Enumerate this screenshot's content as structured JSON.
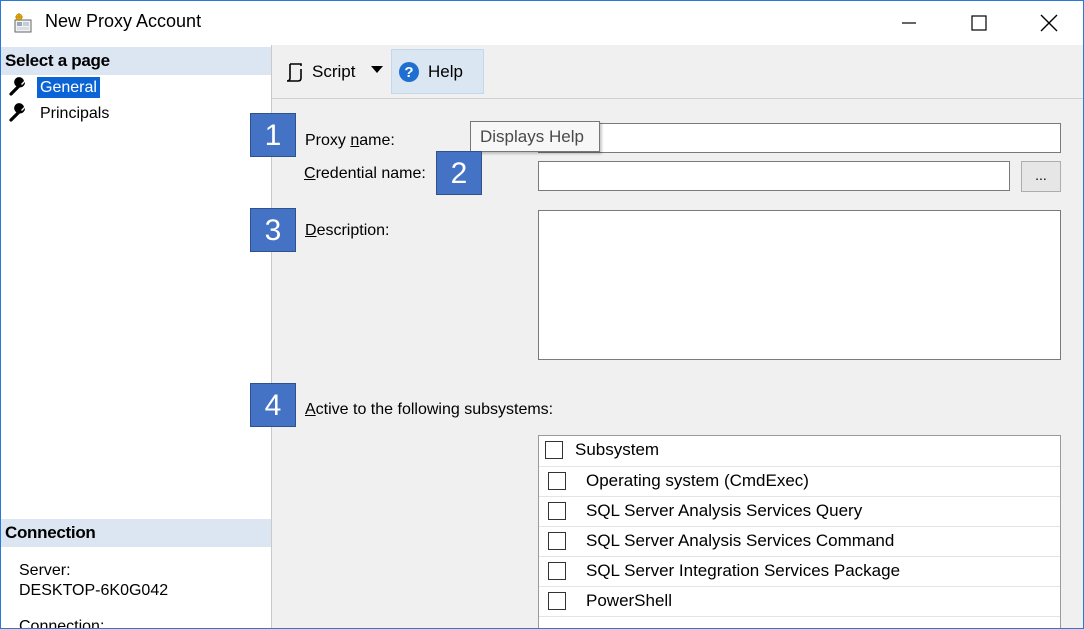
{
  "window": {
    "title": "New Proxy Account"
  },
  "left_pane": {
    "select_page_header": "Select a page",
    "pages": [
      {
        "label": "General",
        "selected": true,
        "icon": "wrench-icon"
      },
      {
        "label": "Principals",
        "selected": false,
        "icon": "wrench-icon"
      }
    ],
    "connection_header": "Connection",
    "server_label": "Server:",
    "server_value": "DESKTOP-6K0G042",
    "connection_label": "Connection:"
  },
  "toolbar": {
    "script_label": "Script",
    "help_label": "Help",
    "help_tooltip": "Displays Help"
  },
  "form": {
    "proxy_name_label_pre": "Proxy ",
    "proxy_name_label_u": "n",
    "proxy_name_label_post": "ame:",
    "proxy_name_value": "",
    "credential_label_u": "C",
    "credential_label_post": "redential name:",
    "credential_value": "",
    "browse_label": "...",
    "description_label_u": "D",
    "description_label_post": "escription:",
    "description_value": "",
    "subsystems_label_u": "A",
    "subsystems_label_post": "ctive to the following subsystems:"
  },
  "badges": [
    "1",
    "2",
    "3",
    "4"
  ],
  "subsystems": {
    "header": "Subsystem",
    "items": [
      {
        "label": "Operating system (CmdExec)",
        "checked": false
      },
      {
        "label": "SQL Server Analysis Services Query",
        "checked": false
      },
      {
        "label": "SQL Server Analysis Services Command",
        "checked": false
      },
      {
        "label": "SQL Server Integration Services Package",
        "checked": false
      },
      {
        "label": "PowerShell",
        "checked": false
      }
    ]
  },
  "colors": {
    "accent": "#0a64d6",
    "badge": "#4472c4",
    "header_bg": "#dce6f2"
  }
}
